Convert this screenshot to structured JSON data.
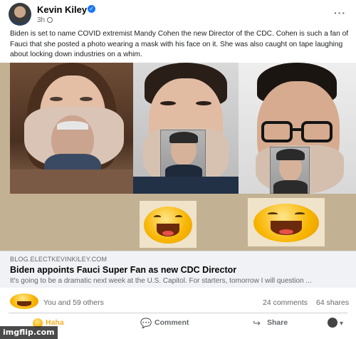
{
  "post": {
    "author": "Kevin Kiley",
    "time": "3h",
    "text": "Biden is set to name COVID extremist Mandy Cohen the new Director of the CDC. Cohen is such a fan of Fauci that she posted a photo wearing a mask with his face on it. She was also caught on tape laughing about locking down industries on a whim.",
    "more_icon": "ellipsis-icon"
  },
  "link": {
    "domain": "BLOG.ELECTKEVINKILEY.COM",
    "title": "Biden appoints Fauci Super Fan as new CDC Director",
    "description": "It's going to be a dramatic next week at the U.S. Capitol. For starters, tomorrow I will question ..."
  },
  "reactions": {
    "summary": "You and 59 others",
    "comments": "24 comments",
    "shares": "64 shares"
  },
  "actions": {
    "haha_label": "Haha",
    "comment_label": "Comment",
    "share_label": "Share",
    "audience_caret": "▾"
  },
  "watermark": "imgflip.com",
  "colors": {
    "accent": "#1877f2",
    "haha": "#f7b125",
    "image_bg": "#c3b193"
  }
}
